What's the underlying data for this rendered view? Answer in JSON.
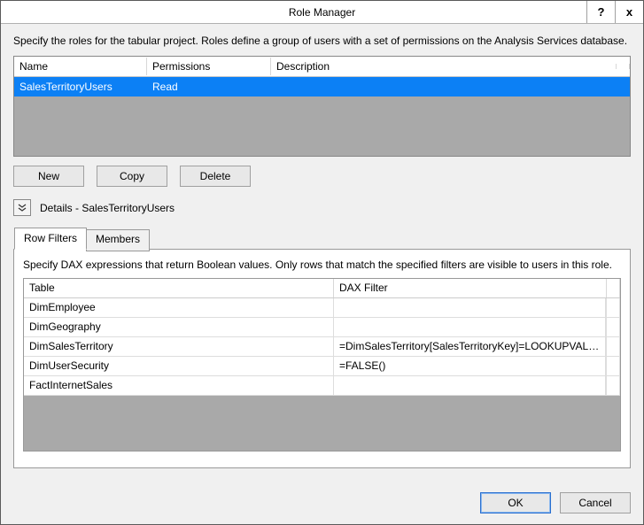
{
  "window": {
    "title": "Role Manager",
    "help_label": "?",
    "close_label": "x"
  },
  "intro": "Specify the roles for the tabular project. Roles define a group of users with a set of permissions on the Analysis Services database.",
  "roles_grid": {
    "headers": {
      "name": "Name",
      "permissions": "Permissions",
      "description": "Description"
    },
    "rows": [
      {
        "name": "SalesTerritoryUsers",
        "permissions": "Read",
        "description": ""
      }
    ]
  },
  "buttons": {
    "new": "New",
    "copy": "Copy",
    "delete": "Delete"
  },
  "details": {
    "label": "Details - SalesTerritoryUsers"
  },
  "tabs": {
    "row_filters": "Row Filters",
    "members": "Members"
  },
  "row_filters_pane": {
    "intro": "Specify DAX expressions that return Boolean values. Only rows that match the specified filters are visible to users in this role.",
    "headers": {
      "table": "Table",
      "dax": "DAX Filter"
    },
    "rows": [
      {
        "table": "DimEmployee",
        "dax": ""
      },
      {
        "table": "DimGeography",
        "dax": ""
      },
      {
        "table": "DimSalesTerritory",
        "dax": "=DimSalesTerritory[SalesTerritoryKey]=LOOKUPVALUE(..."
      },
      {
        "table": "DimUserSecurity",
        "dax": "=FALSE()"
      },
      {
        "table": "FactInternetSales",
        "dax": ""
      }
    ]
  },
  "footer": {
    "ok": "OK",
    "cancel": "Cancel"
  }
}
